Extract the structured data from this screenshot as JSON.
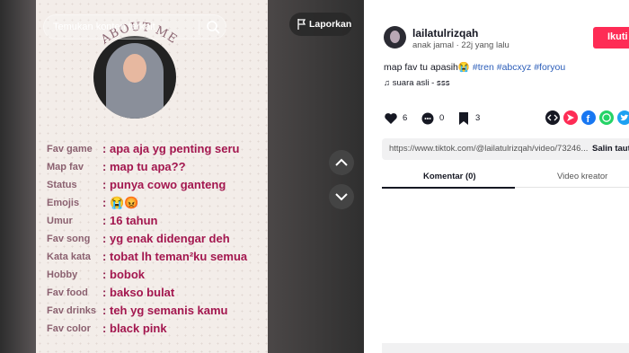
{
  "search": {
    "placeholder": "Temukan konten terkait"
  },
  "report": {
    "label": "Laporkan"
  },
  "card": {
    "heading": "ABOUT ME",
    "rows": [
      {
        "key": "Fav game",
        "value": "apa aja yg penting seru"
      },
      {
        "key": "Map fav",
        "value": "map tu apa??"
      },
      {
        "key": "Status",
        "value": "punya cowo ganteng"
      },
      {
        "key": "Emojis",
        "value": "😭😡"
      },
      {
        "key": "Umur",
        "value": "16 tahun"
      },
      {
        "key": "Fav song",
        "value": "yg enak didengar deh"
      },
      {
        "key": "Kata kata",
        "value": "tobat lh teman²ku semua"
      },
      {
        "key": "Hobby",
        "value": "bobok"
      },
      {
        "key": "Fav food",
        "value": "bakso bulat"
      },
      {
        "key": "Fav drinks",
        "value": "teh yg semanis kamu"
      },
      {
        "key": "Fav color",
        "value": "black pink"
      }
    ],
    "colon": ":"
  },
  "post": {
    "username": "lailatulrizqah",
    "display_name": "anak jamal",
    "dot": "·",
    "time": "22j yang lalu",
    "follow": "Ikuti",
    "caption_text": "map fav tu apasih😭",
    "hashtags": [
      "#tren",
      "#abcxyz",
      "#foryou"
    ],
    "music": "suara asli - ꜱꜱꜱ"
  },
  "stats": {
    "likes": "6",
    "comments": "0",
    "saves": "3"
  },
  "share_colors": [
    "#161823",
    "#fe2c55",
    "#1877f2",
    "#25d366",
    "#1da1f2"
  ],
  "link": {
    "url": "https://www.tiktok.com/@lailatulrizqah/video/73246...",
    "copy": "Salin tautan"
  },
  "tabs": [
    {
      "label": "Komentar (0)",
      "active": true
    },
    {
      "label": "Video kreator",
      "active": false
    }
  ],
  "icons": [
    "search-icon",
    "flag-icon",
    "chevron-up-icon",
    "chevron-down-icon",
    "heart-icon",
    "comment-icon",
    "bookmark-icon",
    "music-icon",
    "embed-icon",
    "send-icon",
    "facebook-icon",
    "whatsapp-icon",
    "twitter-icon"
  ]
}
